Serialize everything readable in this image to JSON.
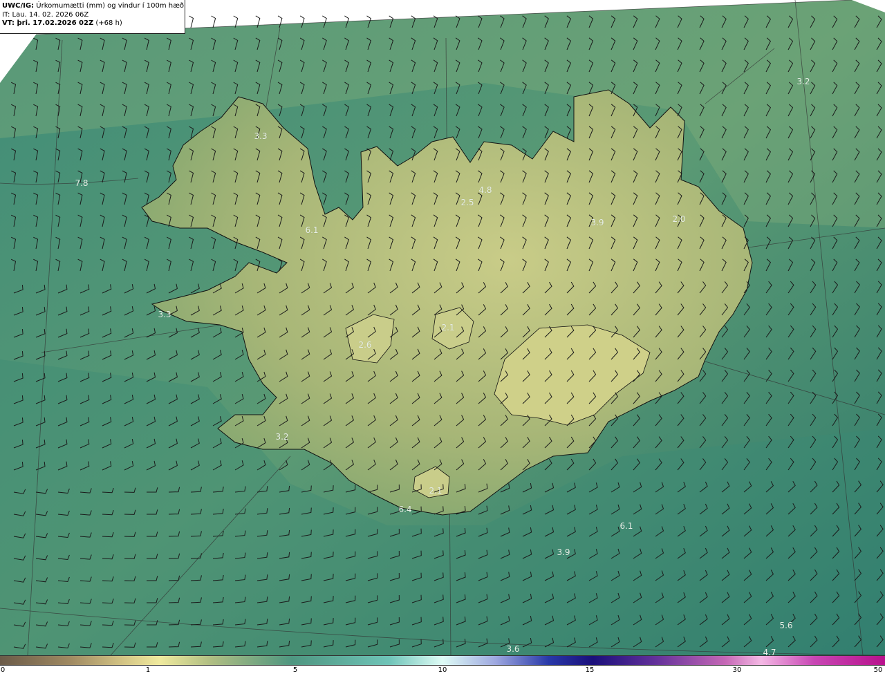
{
  "header": {
    "model": "UWC/IG:",
    "title": "Úrkomumætti (mm) og vindur í 100m hæð",
    "init_line": "IT: Lau. 14. 02. 2026 06Z",
    "valid_line": "VT: þri. 17.02.2026 02Z",
    "lead": "(+68 h)"
  },
  "map_values": [
    "3.3",
    "7.8",
    "6.1",
    "4.8",
    "2.5",
    "3.9",
    "2.0",
    "3.2",
    "3.3",
    "2.6",
    "2.1",
    "3.2",
    "2.1",
    "6.4",
    "6.1",
    "3.9",
    "5.6",
    "3.6",
    "4.7"
  ],
  "legend": {
    "ticks": [
      "0",
      "1",
      "5",
      "10",
      "15",
      "30",
      "50"
    ]
  },
  "colors": {
    "ocean": "#2f7d6e",
    "land": "#b7c27c",
    "coast": "#111111"
  }
}
